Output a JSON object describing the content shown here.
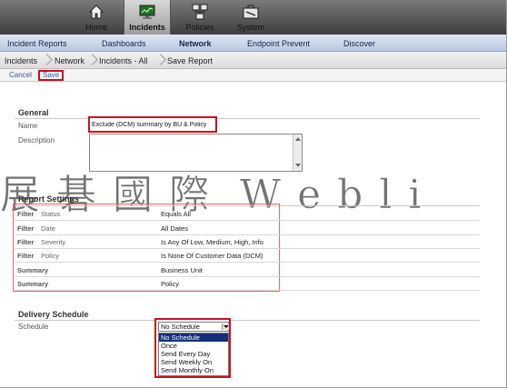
{
  "topnav": {
    "items": [
      {
        "label": "Home",
        "icon": "house-icon"
      },
      {
        "label": "Incidents",
        "icon": "monitor-chart-icon",
        "active": true
      },
      {
        "label": "Policies",
        "icon": "network-icon"
      },
      {
        "label": "System",
        "icon": "toolbox-icon"
      }
    ]
  },
  "subnav": {
    "items": [
      {
        "label": "Incident Reports"
      },
      {
        "label": "Dashboards"
      },
      {
        "label": "Network",
        "active": true
      },
      {
        "label": "Endpoint Prevent"
      },
      {
        "label": "Discover"
      }
    ]
  },
  "breadcrumb": {
    "items": [
      "Incidents",
      "Network",
      "Incidents - All",
      "Save Report"
    ]
  },
  "actions": {
    "cancel": "Cancel",
    "save": "Save"
  },
  "general": {
    "title": "General",
    "name_label": "Name",
    "name_value": "Exclude (DCM) summary by BU & Policy",
    "description_label": "Description"
  },
  "watermark": "展 碁 國 際  W e b l i",
  "report_settings": {
    "title": "Report Settings",
    "rows": [
      {
        "key": "Filter",
        "sub": "Status",
        "value": "Equals  All"
      },
      {
        "key": "Filter",
        "sub": "Date",
        "value": "All Dates"
      },
      {
        "key": "Filter",
        "sub": "Severity",
        "value": "Is Any Of  Low, Medium, High, Info"
      },
      {
        "key": "Filter",
        "sub": "Policy",
        "value": "Is None Of  Customer Data (DCM)"
      },
      {
        "key": "Summary",
        "sub": "",
        "value": "Business Unit"
      },
      {
        "key": "Summary",
        "sub": "",
        "value": "Policy"
      }
    ]
  },
  "delivery": {
    "title": "Delivery Schedule",
    "schedule_label": "Schedule",
    "selected": "No Schedule",
    "options": [
      "No Schedule",
      "Once",
      "Send Every Day",
      "Send Weekly On",
      "Send Monthly On"
    ]
  },
  "colors": {
    "highlight": "#c8101f",
    "subnav": "#c6d4ea",
    "selected_option": "#12307a"
  }
}
